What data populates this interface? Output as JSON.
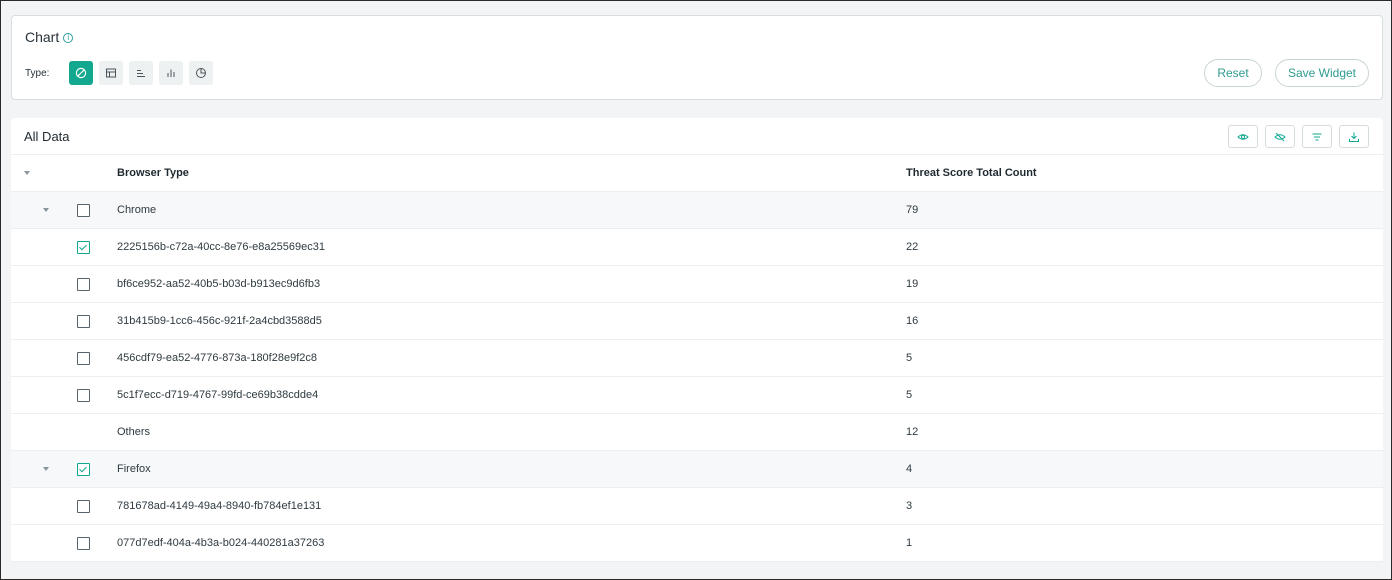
{
  "chart": {
    "title": "Chart",
    "type_label": "Type:",
    "types": [
      {
        "icon": "ban-icon",
        "active": true
      },
      {
        "icon": "table-icon",
        "active": false
      },
      {
        "icon": "bar-horizontal-icon",
        "active": false
      },
      {
        "icon": "bar-vertical-icon",
        "active": false
      },
      {
        "icon": "pie-icon",
        "active": false
      }
    ],
    "reset_label": "Reset",
    "save_label": "Save Widget"
  },
  "table": {
    "title": "All Data",
    "columns": [
      "Browser Type",
      "Threat Score Total Count"
    ],
    "rows": [
      {
        "name": "Chrome",
        "count": "79"
      },
      {
        "name": "2225156b-c72a-40cc-8e76-e8a25569ec31",
        "count": "22"
      },
      {
        "name": "bf6ce952-aa52-40b5-b03d-b913ec9d6fb3",
        "count": "19"
      },
      {
        "name": "31b415b9-1cc6-456c-921f-2a4cbd3588d5",
        "count": "16"
      },
      {
        "name": "456cdf79-ea52-4776-873a-180f28e9f2c8",
        "count": "5"
      },
      {
        "name": "5c1f7ecc-d719-4767-99fd-ce69b38cdde4",
        "count": "5"
      },
      {
        "name": "Others",
        "count": "12"
      },
      {
        "name": "Firefox",
        "count": "4"
      },
      {
        "name": "781678ad-4149-49a4-8940-fb784ef1e131",
        "count": "3"
      },
      {
        "name": "077d7edf-404a-4b3a-b024-440281a37263",
        "count": "1"
      }
    ]
  },
  "colors": {
    "accent": "#12a88f",
    "group_row_bg": "#f6f8f9"
  }
}
